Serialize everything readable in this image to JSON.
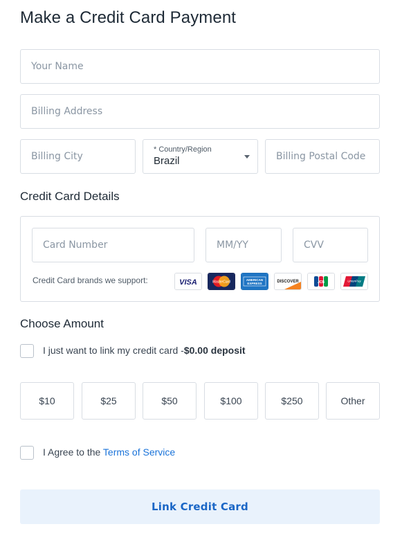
{
  "page": {
    "title": "Make a Credit Card Payment"
  },
  "billing": {
    "name_placeholder": "Your Name",
    "address_placeholder": "Billing Address",
    "city_placeholder": "Billing City",
    "country_label_required": "* ",
    "country_label": "Country/Region",
    "country_value": "Brazil",
    "postal_placeholder": "Billing Postal Code"
  },
  "card": {
    "section_title": "Credit Card Details",
    "number_placeholder": "Card Number",
    "expiry_placeholder": "MM/YY",
    "cvv_placeholder": "CVV",
    "brands_label": "Credit Card brands we support:",
    "brands": [
      {
        "icon": "visa-icon",
        "label": "VISA"
      },
      {
        "icon": "mastercard-icon",
        "label": "MasterCard"
      },
      {
        "icon": "amex-icon",
        "label": "AMERICAN EXPRESS"
      },
      {
        "icon": "discover-icon",
        "label": "DISCOVER"
      },
      {
        "icon": "jcb-icon",
        "label": "JCB"
      },
      {
        "icon": "unionpay-icon",
        "label": "UnionPay"
      }
    ]
  },
  "amount": {
    "section_title": "Choose Amount",
    "link_only_text": "I just want to link my credit card -",
    "link_only_bold": "$0.00 deposit",
    "options": [
      "$10",
      "$25",
      "$50",
      "$100",
      "$250",
      "Other"
    ]
  },
  "terms": {
    "agree_text": "I Agree to the ",
    "link_text": "Terms of Service"
  },
  "submit": {
    "label": "Link Credit Card"
  },
  "colors": {
    "accent": "#1a73d9",
    "submit_bg": "#e9f2fc",
    "submit_text": "#1a66c6",
    "border": "#d8dde3"
  }
}
